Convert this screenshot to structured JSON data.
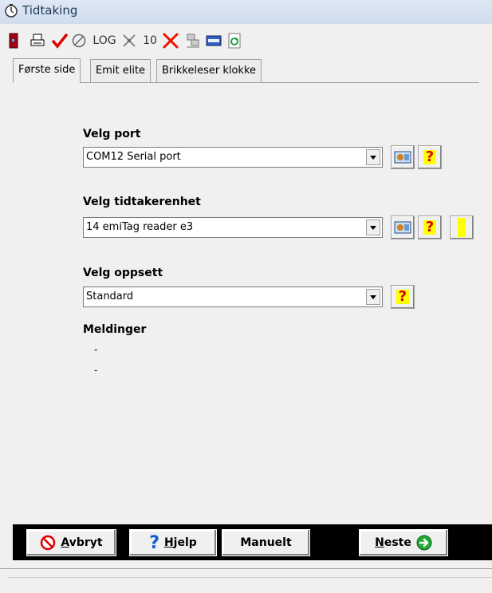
{
  "window": {
    "title": "Tidtaking"
  },
  "toolbar": {
    "items": [
      {
        "name": "exit-icon",
        "label": ""
      },
      {
        "name": "print-icon",
        "label": ""
      },
      {
        "name": "checkmark-icon",
        "label": ""
      },
      {
        "name": "cancel-circle-icon",
        "label": ""
      },
      {
        "name": "log-button",
        "label": "LOG"
      },
      {
        "name": "tools-icon",
        "label": ""
      },
      {
        "name": "ten-button",
        "label": "10"
      },
      {
        "name": "delete-icon",
        "label": ""
      },
      {
        "name": "network-icon",
        "label": ""
      },
      {
        "name": "device-icon",
        "label": ""
      },
      {
        "name": "refresh-icon",
        "label": ""
      }
    ]
  },
  "tabs": [
    {
      "label": "Første side",
      "active": true
    },
    {
      "label": "Emit elite",
      "active": false
    },
    {
      "label": "Brikkeleser klokke",
      "active": false
    }
  ],
  "form": {
    "port": {
      "label": "Velg port",
      "value": "COM12 Serial port"
    },
    "unit": {
      "label": "Velg tidtakerenhet",
      "value": "14 emiTag reader e3"
    },
    "setup": {
      "label": "Velg oppsett",
      "value": "Standard"
    }
  },
  "messages": {
    "label": "Meldinger",
    "lines": [
      "-",
      "-"
    ]
  },
  "buttons": {
    "cancel": {
      "underline": "A",
      "rest": "vbryt"
    },
    "help": {
      "underline": "H",
      "rest": "jelp"
    },
    "manual": {
      "label": "Manuelt"
    },
    "next": {
      "underline": "N",
      "rest": "este"
    }
  },
  "help_symbol": "?",
  "colors": {
    "accent_yellow": "#ffff00",
    "help_red": "#e00000",
    "next_green": "#22aa33"
  }
}
